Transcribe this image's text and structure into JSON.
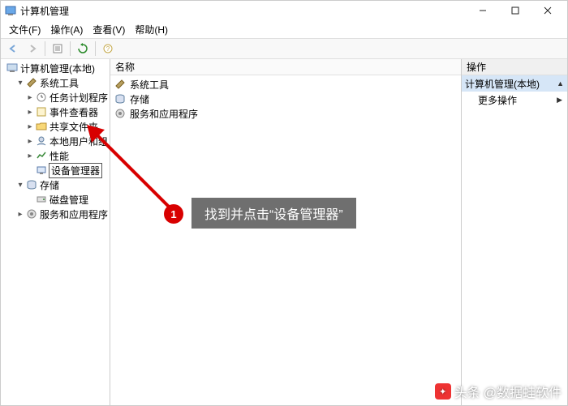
{
  "window": {
    "title": "计算机管理"
  },
  "menu": {
    "file": "文件(F)",
    "operate": "操作(A)",
    "view": "查看(V)",
    "help": "帮助(H)"
  },
  "tree": {
    "root": "计算机管理(本地)",
    "systemTools": "系统工具",
    "taskScheduler": "任务计划程序",
    "eventViewer": "事件查看器",
    "sharedFolders": "共享文件夹",
    "localUsers": "本地用户和组",
    "performance": "性能",
    "deviceManager": "设备管理器",
    "storage": "存储",
    "diskMgmt": "磁盘管理",
    "servicesApps": "服务和应用程序"
  },
  "list": {
    "header": "名称",
    "item1": "系统工具",
    "item2": "存储",
    "item3": "服务和应用程序"
  },
  "actions": {
    "title": "操作",
    "header": "计算机管理(本地)",
    "more": "更多操作"
  },
  "annotation": {
    "step": "1",
    "text": "找到并点击“设备管理器”"
  },
  "watermark": {
    "prefix": "头条",
    "text": "@数据蛙软件"
  }
}
